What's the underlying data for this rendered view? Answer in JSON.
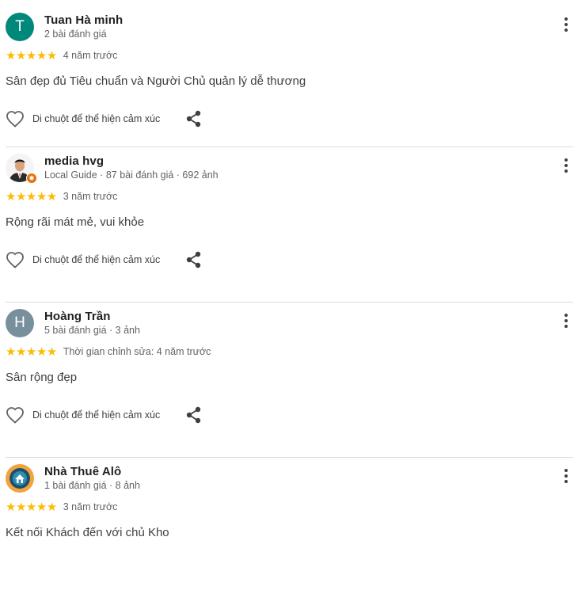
{
  "reviews": [
    {
      "name": "Tuan Hà minh",
      "meta": "2 bài đánh giá",
      "avatar_initial": "T",
      "avatar_color": "#00897b",
      "stars": "★★★★★",
      "time": "4 năm trước",
      "text": "Sân đẹp đủ Tiêu chuẩn và Người Chủ quản lý dễ thương",
      "like_label": "Di chuột để thể hiện cảm xúc"
    },
    {
      "name": "media hvg",
      "meta": "Local Guide · 87 bài đánh giá · 692 ảnh",
      "avatar_icon": "profile-photo-icon",
      "badge_icon": "local-guide-star-icon",
      "badge_color": "#e8710a",
      "stars": "★★★★★",
      "time": "3 năm trước",
      "text": "Rộng rãi mát mẻ, vui khỏe",
      "like_label": "Di chuột để thể hiện cảm xúc"
    },
    {
      "name": "Hoàng Trần",
      "meta": "5 bài đánh giá · 3 ảnh",
      "avatar_initial": "H",
      "avatar_color": "#78909c",
      "stars": "★★★★★",
      "time": "Thời gian chỉnh sửa: 4 năm trước",
      "text": "Sân rộng đẹp",
      "like_label": "Di chuột để thể hiện cảm xúc"
    },
    {
      "name": "Nhà Thuê Alô",
      "meta": "1 bài đánh giá · 8 ảnh",
      "avatar_icon": "house-logo-icon",
      "stars": "★★★★★",
      "time": "3 năm trước",
      "text": "Kết nối Khách đến với chủ Kho"
    }
  ],
  "colors": {
    "star": "#fbbc04",
    "divider": "#dadce0"
  },
  "icons": {
    "more": "more-vert-icon",
    "like": "heart-outline-icon",
    "share": "share-icon"
  }
}
